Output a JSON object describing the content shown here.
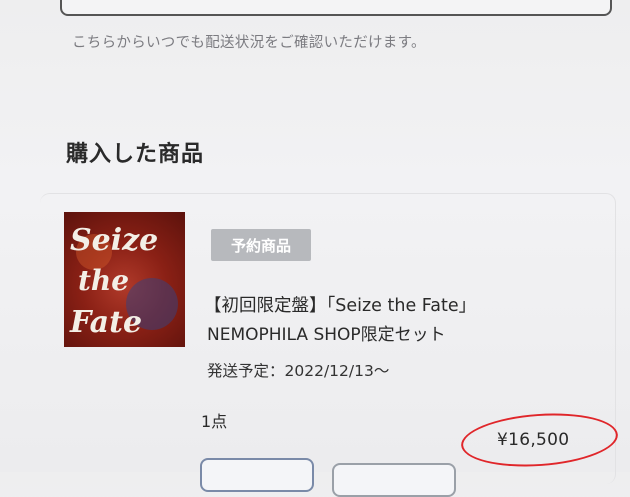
{
  "notice": "こちらからいつでも配送状況をご確認いただけます。",
  "section": {
    "title": "購入した商品"
  },
  "product": {
    "thumbnail_text": [
      "Seize",
      "the",
      "Fate"
    ],
    "badge": "予約商品",
    "name_line1": "【初回限定盤】「Seize the Fate」",
    "name_line2": "NEMOPHILA SHOP限定セット",
    "shipping": "発送予定：2022/12/13〜",
    "quantity": "1点",
    "price": "¥16,500"
  },
  "colors": {
    "badge_bg": "#b7b9bd",
    "highlight_circle": "#e0262a",
    "artwork_red": "#8a2015"
  }
}
